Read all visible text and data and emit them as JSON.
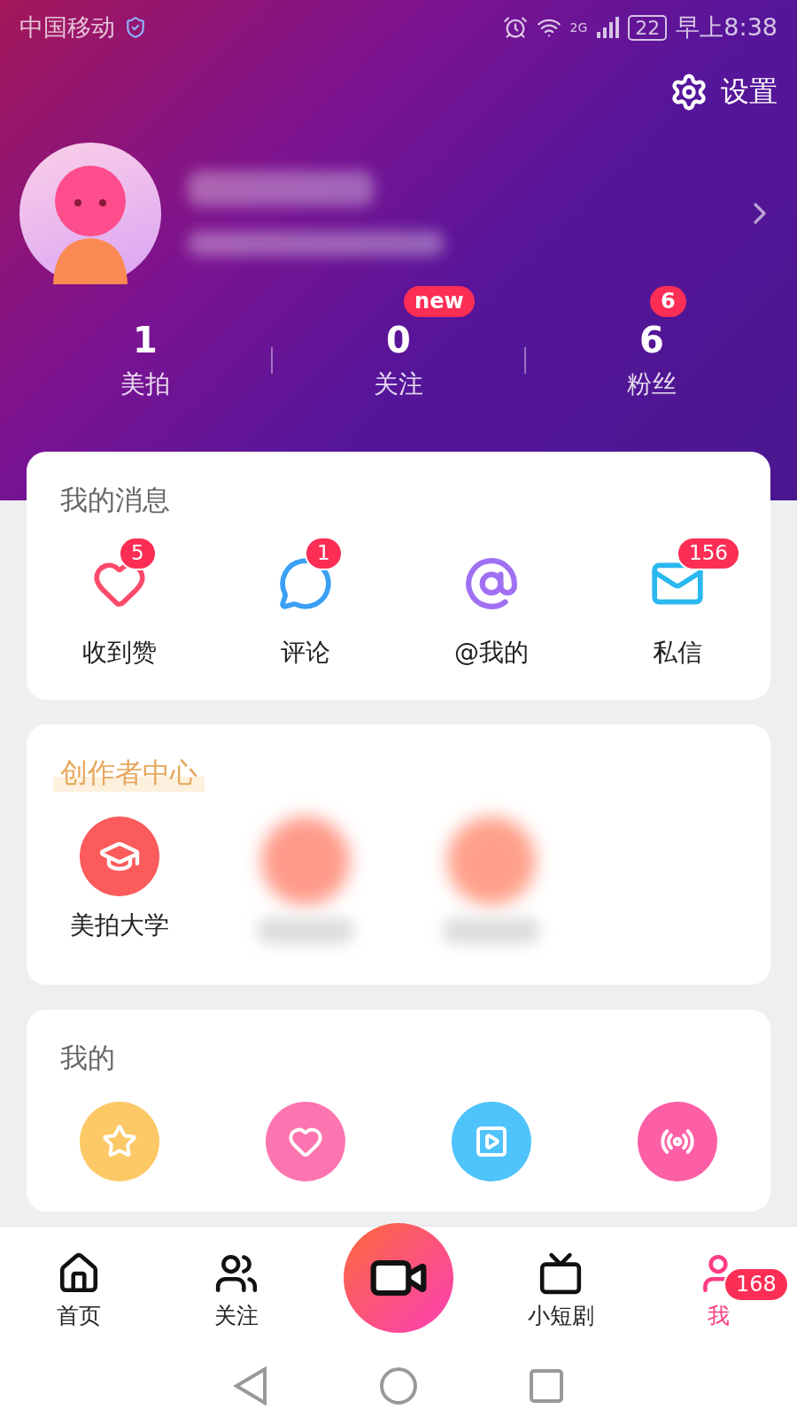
{
  "status_bar": {
    "carrier": "中国移动",
    "network": "2G",
    "battery": "22",
    "time": "早上8:38"
  },
  "header": {
    "settings_label": "设置",
    "stats": [
      {
        "count": "1",
        "label": "美拍"
      },
      {
        "count": "0",
        "label": "关注",
        "badge": "new"
      },
      {
        "count": "6",
        "label": "粉丝",
        "badge": "6"
      }
    ]
  },
  "messages": {
    "title": "我的消息",
    "items": [
      {
        "kind": "like",
        "label": "收到赞",
        "badge": "5"
      },
      {
        "kind": "comment",
        "label": "评论",
        "badge": "1"
      },
      {
        "kind": "mention",
        "label": "@我的"
      },
      {
        "kind": "mail",
        "label": "私信",
        "badge": "156"
      }
    ]
  },
  "creator": {
    "title": "创作者中心",
    "items": [
      {
        "kind": "school",
        "label": "美拍大学"
      },
      {
        "kind": "blurred",
        "color": "#ff9a8a"
      },
      {
        "kind": "blurred",
        "color": "#ffa08a"
      }
    ]
  },
  "mine": {
    "title": "我的",
    "items": [
      {
        "kind": "star",
        "color": "#fdc866"
      },
      {
        "kind": "heart",
        "color": "#fd75b0"
      },
      {
        "kind": "play",
        "color": "#4fc3fb"
      },
      {
        "kind": "live",
        "color": "#fd5fa6"
      }
    ]
  },
  "tab_bar": {
    "items": [
      {
        "kind": "home",
        "label": "首页",
        "selected": false
      },
      {
        "kind": "follow",
        "label": "关注",
        "selected": false
      },
      {
        "kind": "create"
      },
      {
        "kind": "drama",
        "label": "小短剧",
        "selected": false
      },
      {
        "kind": "me",
        "label": "我",
        "selected": true,
        "badge": "168"
      }
    ]
  }
}
